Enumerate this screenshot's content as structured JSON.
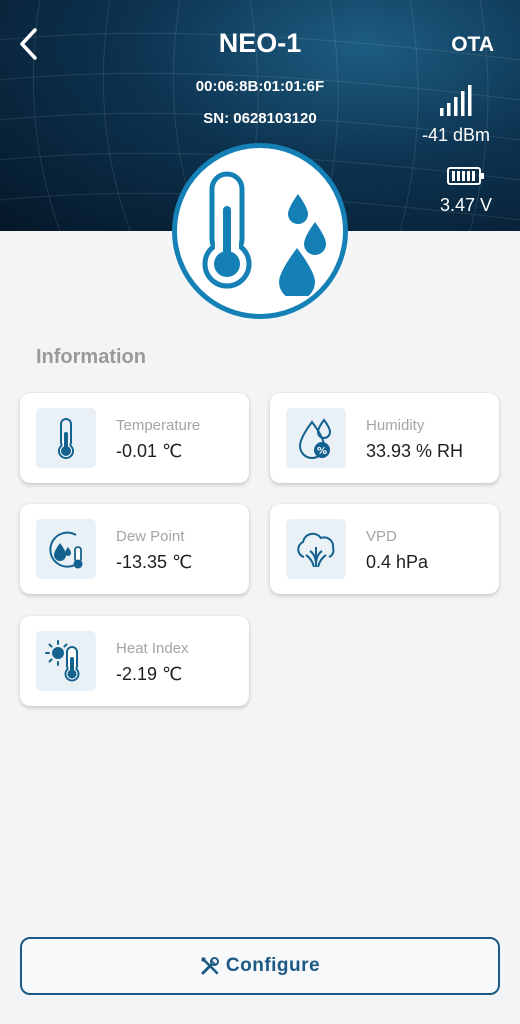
{
  "header": {
    "title": "NEO-1",
    "mac": "00:06:8B:01:01:6F",
    "serial": "SN: 0628103120",
    "ota_label": "OTA",
    "signal": "-41 dBm",
    "battery": "3.47 V"
  },
  "section_title": "Information",
  "cards": [
    {
      "label": "Temperature",
      "value": "-0.01 ℃",
      "icon": "thermometer-icon"
    },
    {
      "label": "Humidity",
      "value": "33.93 % RH",
      "icon": "humidity-drop-icon"
    },
    {
      "label": "Dew Point",
      "value": "-13.35 ℃",
      "icon": "dew-point-icon"
    },
    {
      "label": "VPD",
      "value": "0.4 hPa",
      "icon": "vpd-tree-icon"
    },
    {
      "label": "Heat Index",
      "value": "-2.19 ℃",
      "icon": "heat-index-icon"
    }
  ],
  "configure_label": "Configure",
  "colors": {
    "accent": "#1580b6",
    "icon_blue": "#14628f",
    "icon_bg": "#e9f1f6",
    "button_border": "#1a5a84"
  }
}
